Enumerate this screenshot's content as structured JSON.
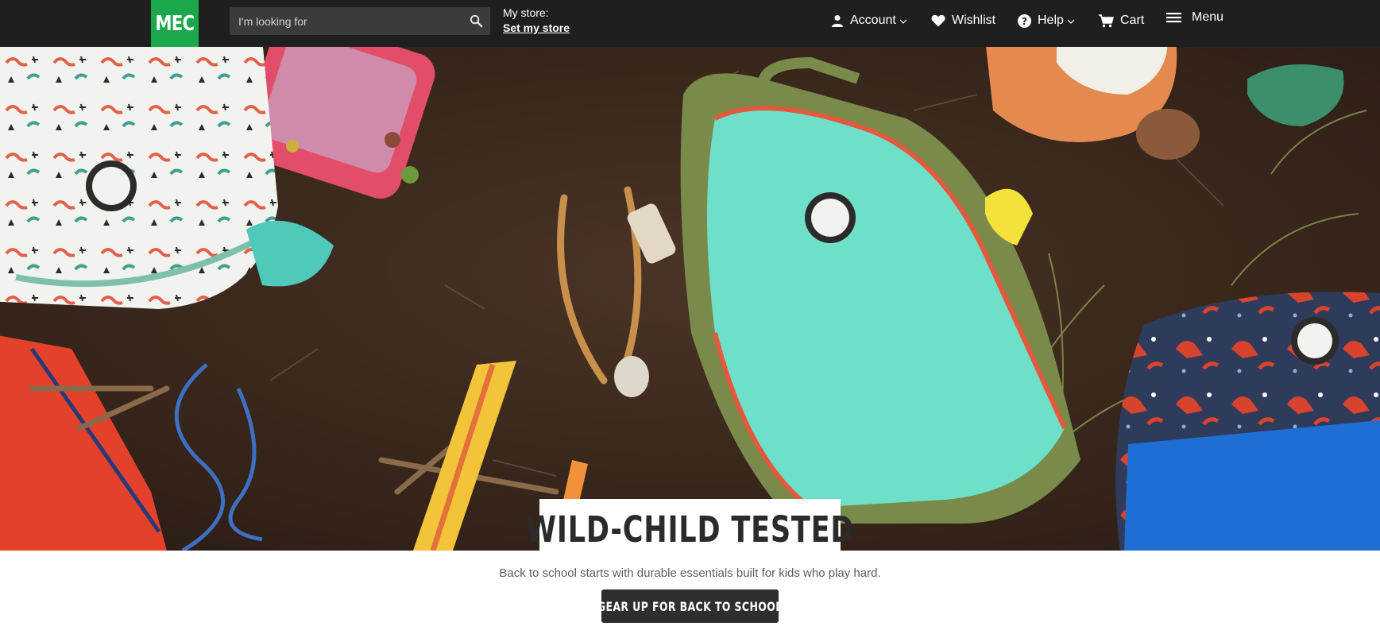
{
  "header": {
    "logo_text": "MEC",
    "brand_color": "#1ba84a",
    "search": {
      "placeholder": "I'm looking for",
      "value": ""
    },
    "store": {
      "label": "My store:",
      "link": "Set my store"
    },
    "nav": {
      "account": "Account",
      "wishlist": "Wishlist",
      "help": "Help",
      "cart": "Cart",
      "menu": "Menu"
    }
  },
  "hero": {
    "headline": "WILD-CHILD TESTED",
    "subtext": "Back to school starts with durable essentials built for kids who play hard.",
    "cta_label": "GEAR UP FOR BACK TO SCHOOL"
  }
}
